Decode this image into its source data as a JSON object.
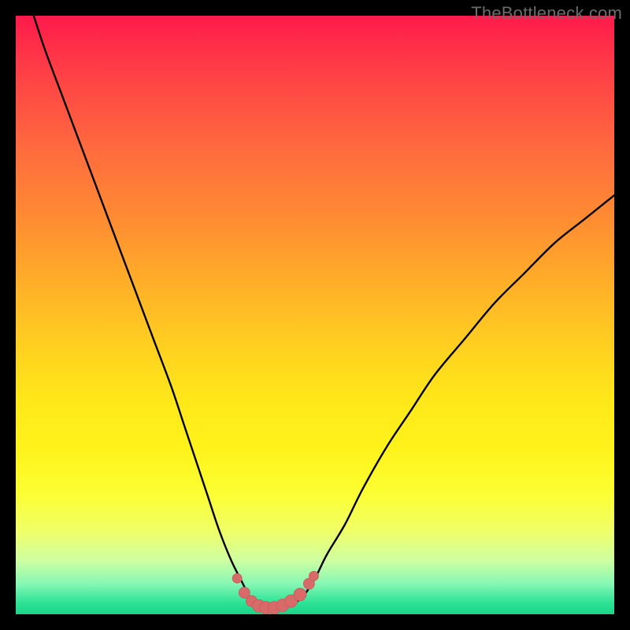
{
  "watermark": {
    "text": "TheBottleneck.com"
  },
  "colors": {
    "frame": "#000000",
    "curve_stroke": "#000000",
    "marker_fill": "#d96a6a",
    "marker_stroke": "#c95a5a"
  },
  "chart_data": {
    "type": "line",
    "title": "",
    "xlabel": "",
    "ylabel": "",
    "xlim": [
      0,
      100
    ],
    "ylim": [
      0,
      100
    ],
    "grid": false,
    "series": [
      {
        "name": "bottleneck-curve",
        "x": [
          3,
          5,
          8,
          11,
          14,
          17,
          20,
          23,
          26,
          28,
          30,
          32,
          34,
          36,
          38,
          39,
          40,
          41,
          42,
          43,
          44,
          46,
          48,
          50,
          52,
          55,
          58,
          62,
          66,
          70,
          75,
          80,
          85,
          90,
          95,
          100
        ],
        "y": [
          100,
          94,
          86,
          78,
          70,
          62,
          54,
          46,
          38,
          32,
          26,
          20,
          14,
          9,
          5,
          3,
          1.7,
          1.1,
          0.9,
          0.9,
          1.1,
          1.6,
          3,
          6,
          10,
          15,
          21,
          28,
          34,
          40,
          46,
          52,
          57,
          62,
          66,
          70
        ]
      }
    ],
    "markers": {
      "name": "valley-markers",
      "x": [
        37.0,
        38.2,
        39.4,
        40.6,
        41.8,
        43.2,
        44.6,
        46.0,
        47.5,
        49.0,
        49.8
      ],
      "y": [
        6.0,
        3.6,
        2.2,
        1.4,
        1.1,
        1.1,
        1.5,
        2.2,
        3.3,
        5.1,
        6.4
      ],
      "r": [
        6,
        7,
        7,
        8,
        8,
        8,
        8,
        8,
        8,
        7,
        6
      ]
    }
  }
}
